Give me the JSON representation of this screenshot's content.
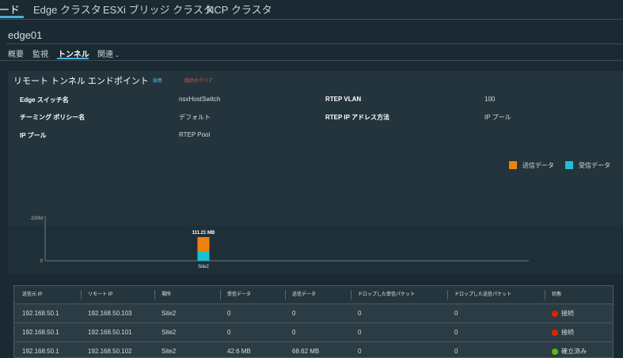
{
  "top_nav": {
    "tabs": [
      "ノード",
      "Edge クラスタ",
      "ESXi ブリッジ クラスタ",
      "NCP クラスタ"
    ]
  },
  "object_title": "edge01",
  "sub_nav": {
    "tabs": [
      "概要",
      "監視",
      "トンネル",
      "関連"
    ]
  },
  "section": {
    "title": "リモート トンネル エンドポイント",
    "edit_label": "編集",
    "clear_label": "統計のクリア"
  },
  "properties": {
    "edge_switch_label": "Edge スイッチ名",
    "edge_switch_value": "nsxHostSwitch",
    "teaming_label": "チーミング ポリシー名",
    "teaming_value": "デフォルト",
    "ip_pool_label": "IP プール",
    "ip_pool_value": "RTEP Pool",
    "rtep_vlan_label": "RTEP VLAN",
    "rtep_vlan_value": "100",
    "rtep_ip_method_label": "RTEP IP アドレス方法",
    "rtep_ip_method_value": "IP プール"
  },
  "legend": {
    "sent_label": "送信データ",
    "received_label": "受信データ",
    "sent_color": "#f0820c",
    "received_color": "#1dc0cf"
  },
  "chart_data": {
    "type": "bar",
    "categories": [
      "Site2"
    ],
    "series": [
      {
        "name": "受信データ",
        "values": [
          42.6
        ]
      },
      {
        "name": "送信データ",
        "values": [
          68.62
        ]
      }
    ],
    "stacked": true,
    "total_labels": [
      "111.21 MB"
    ],
    "y_ticks": [
      "0",
      "200M"
    ],
    "ylim": [
      0,
      200
    ]
  },
  "table": {
    "headers": [
      "送信元 IP",
      "リモート IP",
      "場所",
      "受信データ",
      "送信データ",
      "ドロップした受信パケット",
      "ドロップした送信パケット",
      "状態"
    ],
    "rows": [
      {
        "src": "192.168.50.1",
        "remote": "192.168.50.103",
        "site": "Site2",
        "rx": "0",
        "tx": "0",
        "drop_rx": "0",
        "drop_tx": "0",
        "status": "接続",
        "status_color": "#e12200"
      },
      {
        "src": "192.168.50.1",
        "remote": "192.168.50.101",
        "site": "Site2",
        "rx": "0",
        "tx": "0",
        "drop_rx": "0",
        "drop_tx": "0",
        "status": "接続",
        "status_color": "#e12200"
      },
      {
        "src": "192.168.50.1",
        "remote": "192.168.50.102",
        "site": "Site2",
        "rx": "42.6 MB",
        "tx": "68.62 MB",
        "drop_rx": "0",
        "drop_tx": "0",
        "status": "確立済み",
        "status_color": "#5eb715"
      }
    ]
  }
}
